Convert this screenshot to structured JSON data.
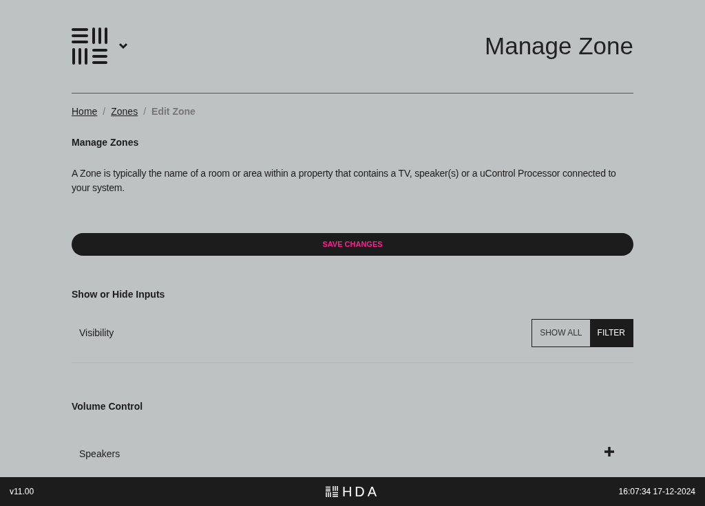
{
  "header": {
    "title": "Manage Zone"
  },
  "breadcrumb": [
    {
      "label": "Home",
      "kind": "link"
    },
    {
      "separator": "/",
      "label": "Zones",
      "kind": "link"
    },
    {
      "separator": "/",
      "label": "Edit Zone",
      "kind": "current"
    }
  ],
  "section": {
    "heading": "Manage Zones",
    "description": "A Zone is typically the name of a room or area within a property that contains a TV, speaker(s) or a uControl Processor connected to your system."
  },
  "save_button": "SAVE CHANGES",
  "inputs": {
    "heading": "Show or Hide Inputs",
    "label": "Visibility",
    "options": [
      {
        "label": "SHOW ALL",
        "selected": false
      },
      {
        "label": "FILTER",
        "selected": true
      }
    ]
  },
  "volume": {
    "heading": "Volume Control",
    "rows": [
      {
        "label": "Speakers"
      }
    ]
  },
  "footer": {
    "version": "v11.00",
    "brand": "HDA",
    "datetime": "16:07:34 17-12-2024"
  }
}
